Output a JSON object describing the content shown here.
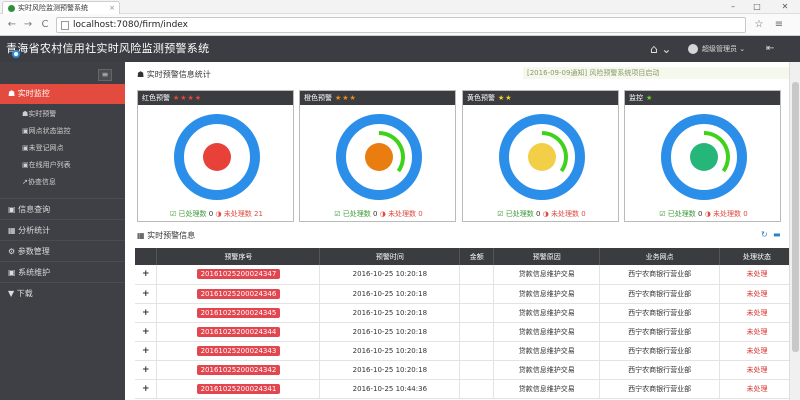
{
  "browser": {
    "tab_title": "实时风险监测预警系统",
    "tab_close": "×",
    "url": "localhost:7080/firm/index",
    "win_min": "–",
    "win_max": "□",
    "win_close": "✕",
    "back": "←",
    "forward": "→",
    "reload": "C",
    "star": "☆",
    "menu": "≡"
  },
  "header": {
    "title": "青海省农村信用社实时风险监测预警系统",
    "home_icon": "⌂ ⌄",
    "user_label": "超级管理员 ⌄",
    "logout_icon": "⇤"
  },
  "sidebar": {
    "collapse": "≡",
    "active": "☗ 实时监控",
    "sub_items": [
      "☗实时预警",
      "▣网点状态监控",
      "▣未登记网点",
      "▣在线用户列表",
      "↗协查信息"
    ],
    "items": [
      "▣ 信息查询",
      "▦ 分析统计",
      "⚙ 参数管理",
      "▣ 系统维护",
      "▼ 下载"
    ]
  },
  "main": {
    "stats_title": "☗ 实时预警信息统计",
    "notice": "[2016-09-09通知] 风险预警系统项目启动",
    "cards": [
      {
        "label": "红色预警",
        "stars": "★★★★",
        "processed_label": "☑ 已处理数",
        "processed": "0",
        "unprocessed_label": "◑ 未处理数",
        "unprocessed": "21",
        "color": "#e8413a",
        "arc": 0
      },
      {
        "label": "橙色预警",
        "stars": "★★★",
        "processed_label": "☑ 已处理数",
        "processed": "0",
        "unprocessed_label": "◑ 未处理数",
        "unprocessed": "0",
        "color": "#ea7d0f",
        "arc": 0.25
      },
      {
        "label": "黄色预警",
        "stars": "★★",
        "processed_label": "☑ 已处理数",
        "processed": "0",
        "unprocessed_label": "◑ 未处理数",
        "unprocessed": "0",
        "color": "#f2cf47",
        "arc": 0.25
      },
      {
        "label": "监控",
        "stars": "★",
        "processed_label": "☑ 已处理数",
        "processed": "0",
        "unprocessed_label": "◑ 未处理数",
        "unprocessed": "0",
        "color": "#27b67a",
        "arc": 0.25
      }
    ],
    "table_title": "▦ 实时预警信息",
    "refresh_icon": "↻",
    "minimize_icon": "▬",
    "table": {
      "headers": [
        "",
        "预警序号",
        "预警时间",
        "金额",
        "预警原因",
        "业务网点",
        "处理状态"
      ],
      "rows": [
        [
          "+",
          "20161025200024347",
          "2016-10-25 10:20:18",
          "",
          "贷款信息维护交易",
          "西宁农商银行营业部",
          "未处理"
        ],
        [
          "+",
          "20161025200024346",
          "2016-10-25 10:20:18",
          "",
          "贷款信息维护交易",
          "西宁农商银行营业部",
          "未处理"
        ],
        [
          "+",
          "20161025200024345",
          "2016-10-25 10:20:18",
          "",
          "贷款信息维护交易",
          "西宁农商银行营业部",
          "未处理"
        ],
        [
          "+",
          "20161025200024344",
          "2016-10-25 10:20:18",
          "",
          "贷款信息维护交易",
          "西宁农商银行营业部",
          "未处理"
        ],
        [
          "+",
          "20161025200024343",
          "2016-10-25 10:20:18",
          "",
          "贷款信息维护交易",
          "西宁农商银行营业部",
          "未处理"
        ],
        [
          "+",
          "20161025200024342",
          "2016-10-25 10:20:18",
          "",
          "贷款信息维护交易",
          "西宁农商银行营业部",
          "未处理"
        ],
        [
          "+",
          "20161025200024341",
          "2016-10-25 10:44:36",
          "",
          "贷款信息维护交易",
          "西宁农商银行营业部",
          "未处理"
        ]
      ]
    }
  }
}
